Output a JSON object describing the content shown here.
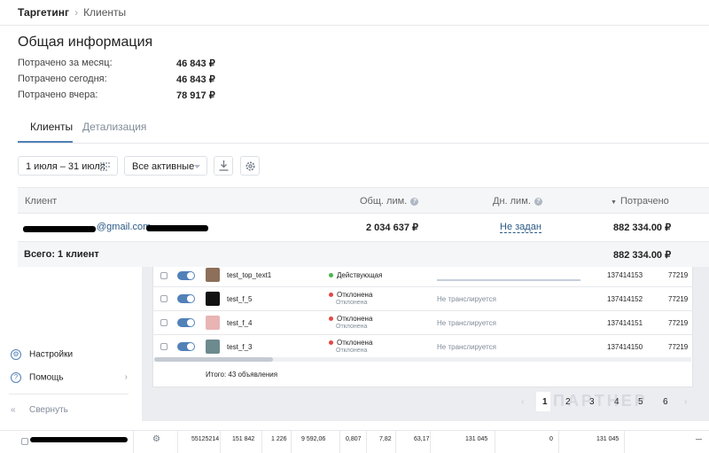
{
  "breadcrumb": {
    "root": "Таргетинг",
    "sep": "›",
    "current": "Клиенты"
  },
  "page_title": "Общая информация",
  "stats": [
    {
      "label": "Потрачено за месяц:",
      "value": "46 843 ₽"
    },
    {
      "label": "Потрачено сегодня:",
      "value": "46 843 ₽"
    },
    {
      "label": "Потрачено вчера:",
      "value": "78 917 ₽"
    }
  ],
  "tabs": [
    {
      "label": "Клиенты",
      "active": true
    },
    {
      "label": "Детализация",
      "active": false
    }
  ],
  "toolbar": {
    "date_range": "1 июля – 31 июля",
    "filter": "Все активные"
  },
  "table": {
    "headers": {
      "client": "Клиент",
      "total_limit": "Общ. лим.",
      "day_limit": "Дн. лим.",
      "spent": "Потрачено"
    },
    "row": {
      "email_suffix": "@gmail.com",
      "total_limit": "2 034 637 ₽",
      "day_limit": "Не задан",
      "spent": "882 334.00 ₽"
    },
    "total": {
      "label": "Всего: 1 клиент",
      "spent": "882 334.00 ₽"
    }
  },
  "sidebar": {
    "settings": "Настройки",
    "help": "Помощь",
    "collapse": "Свернуть"
  },
  "ads": [
    {
      "name": "test_top_text1",
      "status": "Действующая",
      "status_sub": "",
      "status_color": "#4bb34b",
      "broadcast": "",
      "id": "137414153",
      "extra": "77219",
      "thumb": "#8d6f5a"
    },
    {
      "name": "test_f_5",
      "status": "Отклонена",
      "status_sub": "Отклонена",
      "status_color": "#e64646",
      "broadcast": "Не транслируется",
      "id": "137414152",
      "extra": "77219",
      "thumb": "#111111"
    },
    {
      "name": "test_f_4",
      "status": "Отклонена",
      "status_sub": "Отклонена",
      "status_color": "#e64646",
      "broadcast": "Не транслируется",
      "id": "137414151",
      "extra": "77219",
      "thumb": "#e8b4b4"
    },
    {
      "name": "test_f_3",
      "status": "Отклонена",
      "status_sub": "Отклонена",
      "status_color": "#e64646",
      "broadcast": "Не транслируется",
      "id": "137414150",
      "extra": "77219",
      "thumb": "#6d8a8f"
    }
  ],
  "ads_total": "Итого: 43 объявления",
  "pagination": [
    "1",
    "2",
    "3",
    "4",
    "5",
    "6"
  ],
  "watermark": "ПАРТНЕР",
  "bottom_row": [
    "55125214",
    "151 842",
    "1 226",
    "9 592,06",
    "0,807",
    "7,82",
    "63,17",
    "131 045",
    "0",
    "131 045",
    "—"
  ],
  "colors": {
    "accent": "#5181b8",
    "header_bg": "#f5f6f8",
    "border": "#e7e8ec"
  }
}
